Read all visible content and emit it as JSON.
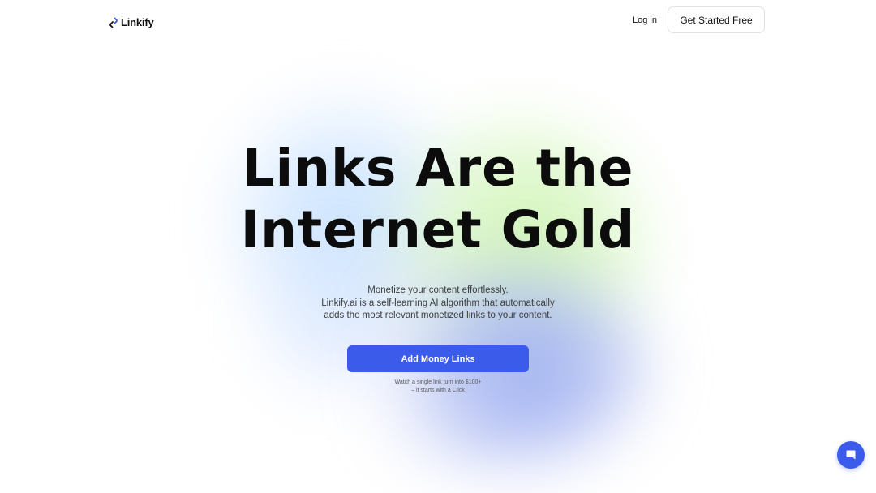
{
  "nav": {
    "logo_text": "Linkify",
    "login_label": "Log in",
    "cta_label": "Get Started Free"
  },
  "hero": {
    "title_line1": "Links Are the",
    "title_line2": "Internet Gold",
    "subtitle_lines": [
      "Monetize your content effortlessly.",
      "Linkify.ai is a self-learning AI algorithm that automatically",
      "adds the most relevant monetized links to your content."
    ],
    "button_label": "Add Money Links",
    "note_lines": [
      "Watch a single link turn into $100+",
      "– it starts with a Click"
    ]
  },
  "chat": {
    "icon": "chat-bubble-icon"
  },
  "colors": {
    "accent": "#3b5bea",
    "text": "#0c0c0c",
    "blob_blue": "#c4e0ff",
    "blob_green": "#cef4b0",
    "blob_violet": "#96a8f0"
  }
}
